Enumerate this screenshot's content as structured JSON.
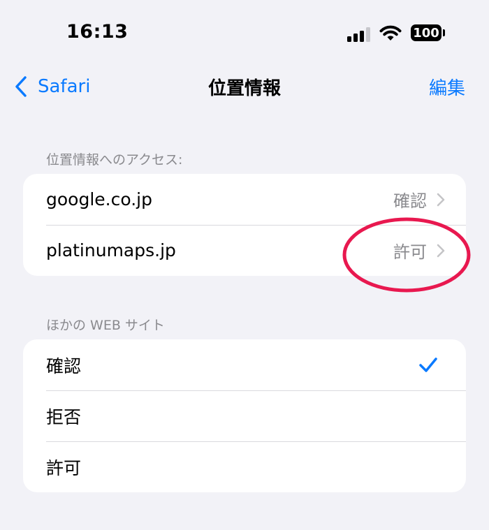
{
  "status_bar": {
    "time": "16:13",
    "battery": "100"
  },
  "nav": {
    "back_label": "Safari",
    "title": "位置情報",
    "edit_label": "編集"
  },
  "sections": {
    "access": {
      "header": "位置情報へのアクセス:",
      "rows": [
        {
          "label": "google.co.jp",
          "value": "確認"
        },
        {
          "label": "platinumaps.jp",
          "value": "許可"
        }
      ]
    },
    "other": {
      "header": "ほかの WEB サイト",
      "rows": [
        {
          "label": "確認",
          "selected": true
        },
        {
          "label": "拒否",
          "selected": false
        },
        {
          "label": "許可",
          "selected": false
        }
      ]
    }
  },
  "colors": {
    "accent": "#0a7aff",
    "annotation": "#e8184f",
    "background": "#f2f2f7"
  },
  "icons": [
    "cellular-signal-icon",
    "wifi-icon",
    "battery-icon",
    "back-chevron-icon",
    "chevron-right-icon",
    "checkmark-icon"
  ]
}
